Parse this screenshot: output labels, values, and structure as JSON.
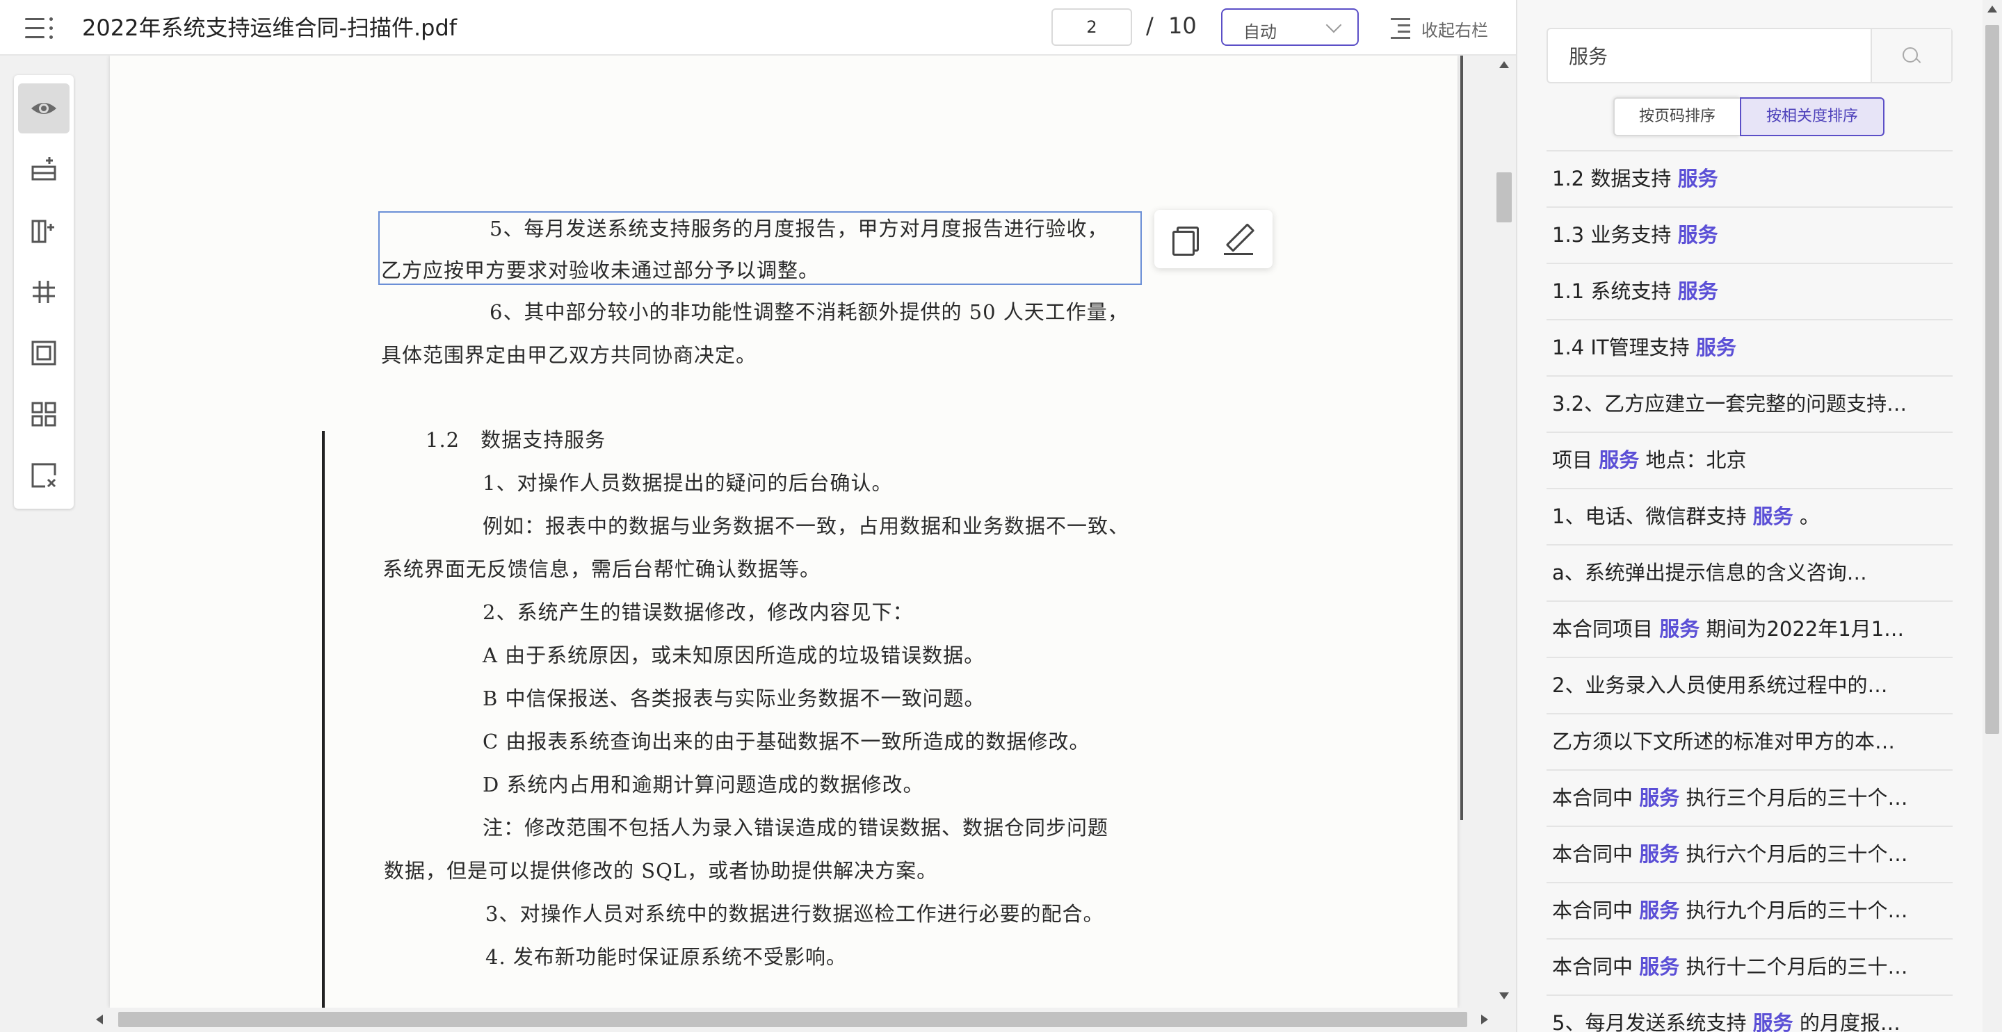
{
  "header": {
    "file_name": "2022年系统支持运维合同-扫描件.pdf",
    "current_page": "2",
    "page_separator": "/",
    "total_pages": "10",
    "zoom": "自动",
    "collapse_right_label": "收起右栏"
  },
  "document": {
    "selected_lines": [
      "5、每月发送系统支持服务的月度报告，甲方对月度报告进行验收，",
      "乙方应按甲方要求对验收未通过部分予以调整。"
    ],
    "lines": [
      "6、其中部分较小的非功能性调整不消耗额外提供的 50 人天工作量，",
      "具体范围界定由甲乙双方共同协商决定。",
      "1.2　数据支持服务",
      "1、对操作人员数据提出的疑问的后台确认。",
      "例如：报表中的数据与业务数据不一致，占用数据和业务数据不一致、",
      "系统界面无反馈信息，需后台帮忙确认数据等。",
      "2、系统产生的错误数据修改，修改内容见下：",
      "A 由于系统原因，或未知原因所造成的垃圾错误数据。",
      "B 中信保报送、各类报表与实际业务数据不一致问题。",
      "C 由报表系统查询出来的由于基础数据不一致所造成的数据修改。",
      "D 系统内占用和逾期计算问题造成的数据修改。",
      "注：修改范围不包括人为录入错误造成的错误数据、数据仓同步问题",
      "数据，但是可以提供修改的 SQL，或者协助提供解决方案。",
      "3、对操作人员对系统中的数据进行数据巡检工作进行必要的配合。",
      "4. 发布新功能时保证原系统不受影响。"
    ]
  },
  "tools": [
    "eye-icon",
    "insert-row-icon",
    "insert-column-icon",
    "split-icon",
    "crop-icon",
    "grid-icon",
    "delete-region-icon"
  ],
  "search": {
    "query": "服务",
    "sort_by_page": "按页码排序",
    "sort_by_relevance": "按相关度排序",
    "results": [
      {
        "pre": "1.2 数据支持 ",
        "hl": "服务",
        "post": ""
      },
      {
        "pre": "1.3 业务支持 ",
        "hl": "服务",
        "post": ""
      },
      {
        "pre": "1.1 系统支持 ",
        "hl": "服务",
        "post": ""
      },
      {
        "pre": "1.4 IT管理支持 ",
        "hl": "服务",
        "post": ""
      },
      {
        "pre": "3.2、乙方应建立一套完整的问题支持…",
        "hl": "",
        "post": ""
      },
      {
        "pre": "项目 ",
        "hl": "服务",
        "post": " 地点：北京"
      },
      {
        "pre": "1、电话、微信群支持 ",
        "hl": "服务",
        "post": " 。"
      },
      {
        "pre": "a、系统弹出提示信息的含义咨询…",
        "hl": "",
        "post": ""
      },
      {
        "pre": "本合同项目 ",
        "hl": "服务",
        "post": " 期间为2022年1月1…"
      },
      {
        "pre": "2、业务录入人员使用系统过程中的…",
        "hl": "",
        "post": ""
      },
      {
        "pre": "乙方须以下文所述的标准对甲方的本…",
        "hl": "",
        "post": ""
      },
      {
        "pre": "本合同中 ",
        "hl": "服务",
        "post": " 执行三个月后的三十个…"
      },
      {
        "pre": "本合同中 ",
        "hl": "服务",
        "post": " 执行六个月后的三十个…"
      },
      {
        "pre": "本合同中 ",
        "hl": "服务",
        "post": " 执行九个月后的三十个…"
      },
      {
        "pre": "本合同中 ",
        "hl": "服务",
        "post": " 执行十二个月后的三十…"
      },
      {
        "pre": "5、每月发送系统支持 ",
        "hl": "服务",
        "post": " 的月度报…"
      }
    ]
  }
}
